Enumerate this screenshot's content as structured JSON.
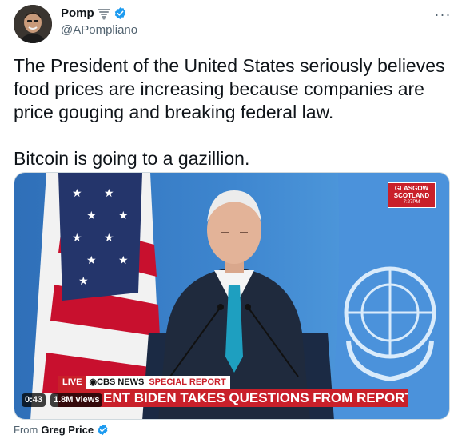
{
  "author": {
    "display_name": "Pomp",
    "handle": "@APompliano",
    "avatar_icon": "avatar-photo",
    "badge_emoji_icon": "tornado-icon",
    "verified_icon": "verified-badge-icon"
  },
  "more_icon": "more-options-icon",
  "more_label": "···",
  "tweet": {
    "paragraph_1": "The President of the United States seriously believes food prices are increasing because companies are price gouging and breaking federal law.",
    "paragraph_2": "Bitcoin is going to a gazillion."
  },
  "video": {
    "location_line1": "GLASGOW",
    "location_line2": "SCOTLAND",
    "location_time": "7:27PM",
    "live_label": "LIVE",
    "network_label": "◉CBS NEWS",
    "special_report_label": "SPECIAL REPORT",
    "headline": "ENT BIDEN TAKES QUESTIONS FROM REPORTERS",
    "duration": "0:43",
    "views": "1.8M views"
  },
  "footer": {
    "from_label": "From",
    "from_user": "Greg Price"
  },
  "colors": {
    "verified_blue": "#1d9bf0",
    "secondary_text": "#536471",
    "cbs_red": "#c9202a",
    "un_blue": "#4b92db"
  }
}
